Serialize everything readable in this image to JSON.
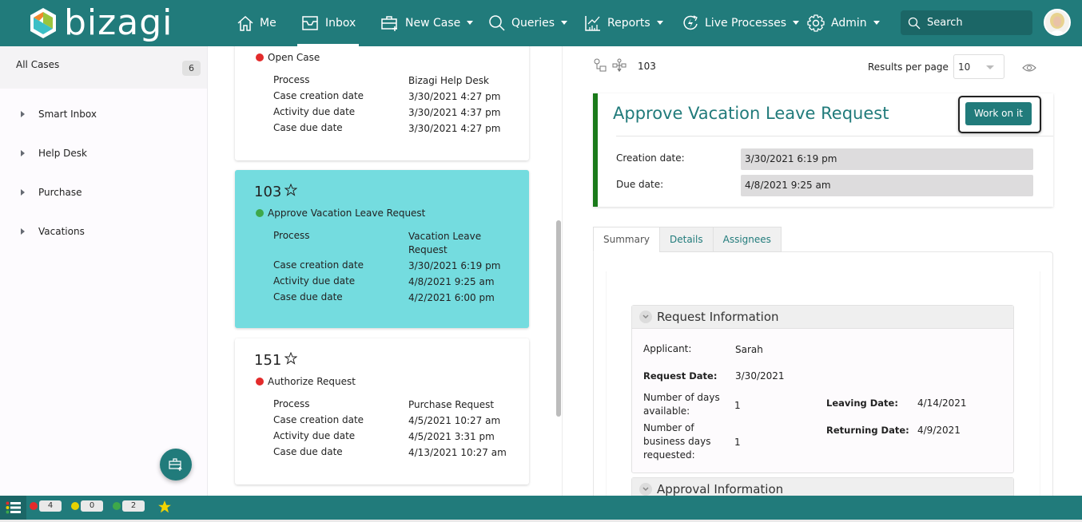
{
  "app": {
    "brand": "bizagi"
  },
  "nav": {
    "items": [
      {
        "id": "me",
        "label": "Me",
        "icon": "home-icon",
        "dropdown": false,
        "active": false
      },
      {
        "id": "inbox",
        "label": "Inbox",
        "icon": "inbox-icon",
        "dropdown": false,
        "active": true
      },
      {
        "id": "new-case",
        "label": "New Case",
        "icon": "new-case-icon",
        "dropdown": true,
        "active": false
      },
      {
        "id": "queries",
        "label": "Queries",
        "icon": "search-icon",
        "dropdown": true,
        "active": false
      },
      {
        "id": "reports",
        "label": "Reports",
        "icon": "reports-icon",
        "dropdown": true,
        "active": false
      },
      {
        "id": "live-processes",
        "label": "Live Processes",
        "icon": "live-process-icon",
        "dropdown": true,
        "active": false
      },
      {
        "id": "admin",
        "label": "Admin",
        "icon": "gear-icon",
        "dropdown": true,
        "active": false
      }
    ],
    "search_placeholder": "Search"
  },
  "sidebar": {
    "all_cases": {
      "label": "All Cases",
      "count": "6"
    },
    "items": [
      {
        "label": "Smart Inbox"
      },
      {
        "label": "Help Desk"
      },
      {
        "label": "Purchase"
      },
      {
        "label": "Vacations"
      }
    ],
    "fab_icon": "new-case-icon"
  },
  "cases": [
    {
      "number": "",
      "activity": "Open Case",
      "status_color": "#e32b2b",
      "selected": false,
      "fields": [
        {
          "key": "Process",
          "value": "Bizagi Help Desk"
        },
        {
          "key": "Case creation date",
          "value": "3/30/2021 4:27 pm"
        },
        {
          "key": "Activity due date",
          "value": "3/30/2021 4:37 pm"
        },
        {
          "key": "Case due date",
          "value": "3/30/2021 4:27 pm"
        }
      ]
    },
    {
      "number": "103",
      "activity": "Approve Vacation Leave Request",
      "status_color": "#3ea84a",
      "selected": true,
      "fields": [
        {
          "key": "Process",
          "value": "Vacation Leave Request"
        },
        {
          "key": "Case creation date",
          "value": "3/30/2021 6:19 pm"
        },
        {
          "key": "Activity due date",
          "value": "4/8/2021 9:25 am"
        },
        {
          "key": "Case due date",
          "value": "4/2/2021 6:00 pm"
        }
      ]
    },
    {
      "number": "151",
      "activity": "Authorize Request",
      "status_color": "#e32b2b",
      "selected": false,
      "fields": [
        {
          "key": "Process",
          "value": "Purchase Request"
        },
        {
          "key": "Case creation date",
          "value": "4/5/2021 10:27 am"
        },
        {
          "key": "Activity due date",
          "value": "4/5/2021 3:31 pm"
        },
        {
          "key": "Case due date",
          "value": "4/13/2021 10:27 am"
        }
      ]
    }
  ],
  "detail": {
    "case_number": "103",
    "results_per_page_label": "Results per page",
    "results_per_page_value": "10",
    "title": "Approve Vacation Leave Request",
    "work_button": "Work on it",
    "creation_label": "Creation date:",
    "creation_value": "3/30/2021 6:19 pm",
    "due_label": "Due date:",
    "due_value": "4/8/2021 9:25 am",
    "tabs": [
      {
        "label": "Summary",
        "active": true
      },
      {
        "label": "Details",
        "active": false
      },
      {
        "label": "Assignees",
        "active": false
      }
    ],
    "request_group": {
      "title": "Request Information",
      "applicant_label": "Applicant:",
      "applicant_value": "Sarah",
      "request_date_label": "Request Date:",
      "request_date_value": "3/30/2021",
      "days_available_label": "Number of days available:",
      "days_available_value": "1",
      "business_days_label": "Number of business days requested:",
      "business_days_value": "1",
      "leaving_date_label": "Leaving Date:",
      "leaving_date_value": "4/14/2021",
      "returning_date_label": "Returning Date:",
      "returning_date_value": "4/9/2021"
    },
    "approval_group": {
      "title": "Approval Information"
    }
  },
  "bottombar": {
    "counters": [
      {
        "color": "#e32b2b",
        "value": "4"
      },
      {
        "color": "#e6d200",
        "value": "0"
      },
      {
        "color": "#3ea84a",
        "value": "2"
      }
    ],
    "favorites_icon": "star-icon"
  },
  "colors": {
    "brand": "#217b7b",
    "selected_card": "#74dcdf",
    "status_red": "#e32b2b",
    "status_green": "#3ea84a",
    "status_yellow": "#e6d200"
  }
}
